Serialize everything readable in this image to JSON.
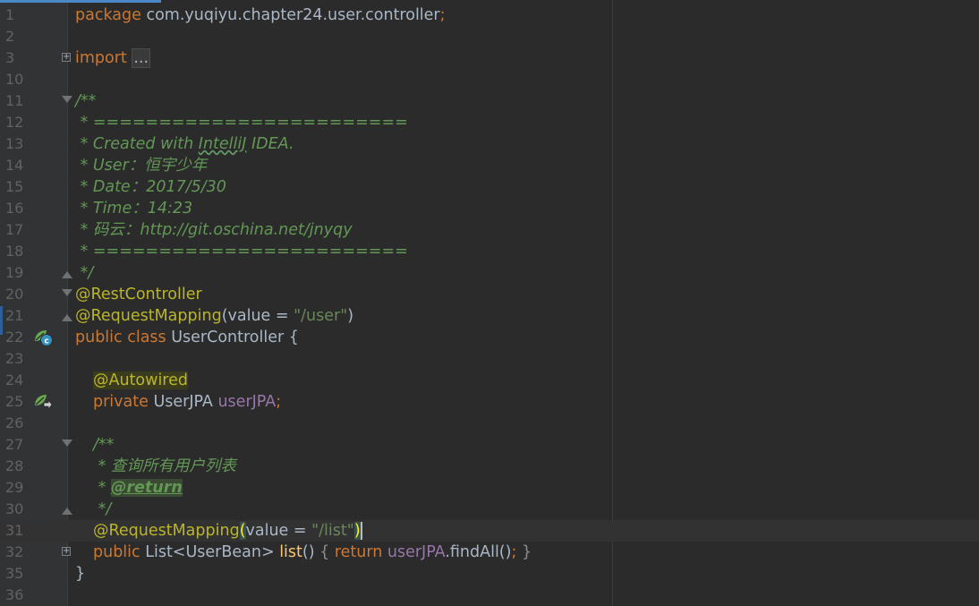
{
  "editor": {
    "lines": [
      {
        "n": "1"
      },
      {
        "n": "2"
      },
      {
        "n": "3"
      },
      {
        "n": "10"
      },
      {
        "n": "11"
      },
      {
        "n": "12"
      },
      {
        "n": "13"
      },
      {
        "n": "14"
      },
      {
        "n": "15"
      },
      {
        "n": "16"
      },
      {
        "n": "17"
      },
      {
        "n": "18"
      },
      {
        "n": "19"
      },
      {
        "n": "20"
      },
      {
        "n": "21"
      },
      {
        "n": "22"
      },
      {
        "n": "23"
      },
      {
        "n": "24"
      },
      {
        "n": "25"
      },
      {
        "n": "26"
      },
      {
        "n": "27"
      },
      {
        "n": "28"
      },
      {
        "n": "29"
      },
      {
        "n": "30"
      },
      {
        "n": "31"
      },
      {
        "n": "32"
      },
      {
        "n": "35"
      },
      {
        "n": "36"
      }
    ],
    "code": {
      "l1_kw": "package",
      "l1_rest": " com.yuqiyu.chapter24.user.controller",
      "l1_semi": ";",
      "l3_kw": "import",
      "l3_fold": "...",
      "l11": "/**",
      "l12": " * ========================",
      "l13_a": " * Created with ",
      "l13_b": "IntelliJ",
      "l13_c": " IDEA.",
      "l14": " * User：恒宇少年",
      "l15": " * Date：2017/5/30",
      "l16": " * Time：14:23",
      "l17": " * 码云：http://git.oschina.net/jnyqy",
      "l18": " * ========================",
      "l19": " */",
      "l20": "@RestController",
      "l21_ann": "@RequestMapping",
      "l21_open": "(value = ",
      "l21_str": "\"/user\"",
      "l21_close": ")",
      "l22_kw": "public class",
      "l22_rest": " UserController {",
      "l24": "@Autowired",
      "l25_kw": "private",
      "l25_type": " UserJPA ",
      "l25_field": "userJPA",
      "l25_semi": ";",
      "l27": "/**",
      "l28": " * 查询所有用户列表",
      "l29_a": " * ",
      "l29_tag": "@return",
      "l30": " */",
      "l31_ann": "@RequestMapping",
      "l31_open": "(",
      "l31_mid": "value = ",
      "l31_str": "\"/list\"",
      "l31_close": ")",
      "l32_kw": "public",
      "l32_type": " List<UserBean> ",
      "l32_method": "list",
      "l32_parens": "() ",
      "l32_lb": "{ ",
      "l32_ret": "return",
      "l32_field": " userJPA",
      "l32_call": ".findAll()",
      "l32_semi": ";",
      "l32_rb": " }",
      "l35": "}"
    },
    "gutter_icons": {
      "line22": "spring-bean-class-icon",
      "line25": "spring-autowired-navigate-icon"
    },
    "colors": {
      "background": "#2b2b2b",
      "keyword": "#cc7832",
      "annotation": "#bbb529",
      "string": "#6a8759",
      "doc_comment": "#629755",
      "field": "#9876aa",
      "plain": "#a9b7c6",
      "line_number": "#606366"
    }
  }
}
